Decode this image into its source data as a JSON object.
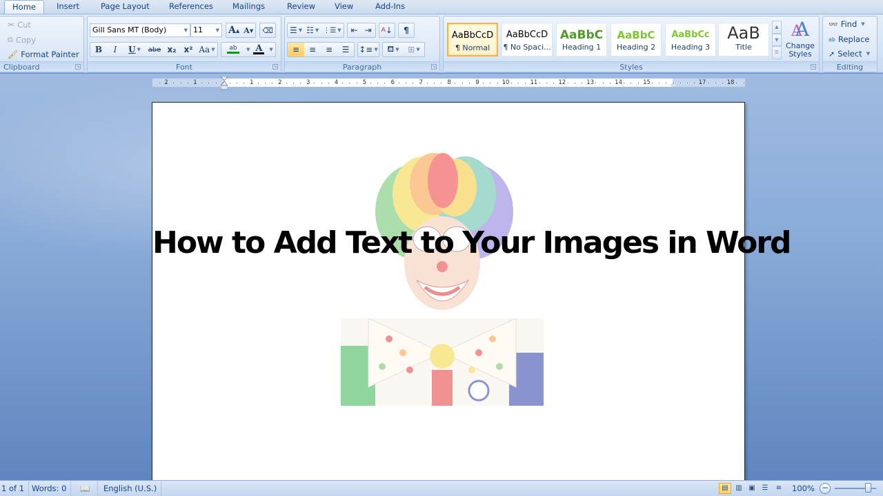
{
  "tabs": [
    {
      "label": "Home",
      "active": true
    },
    {
      "label": "Insert"
    },
    {
      "label": "Page Layout"
    },
    {
      "label": "References"
    },
    {
      "label": "Mailings"
    },
    {
      "label": "Review"
    },
    {
      "label": "View"
    },
    {
      "label": "Add-Ins"
    }
  ],
  "clipboard": {
    "label": "Clipboard",
    "cut": "Cut",
    "copy": "Copy",
    "format_painter": "Format Painter"
  },
  "font": {
    "label": "Font",
    "font_name": "Gill Sans MT (Body)",
    "font_size": "11",
    "grow": "A",
    "shrink": "A",
    "bold": "B",
    "italic": "I",
    "underline": "U",
    "strikethrough": "abe",
    "subscript": "x₂",
    "superscript": "x²",
    "change_case": "Aa",
    "highlight": "ab",
    "font_color_glyph": "A",
    "highlight_color": "#00a000",
    "font_color": "#000000"
  },
  "paragraph": {
    "label": "Paragraph",
    "pilcrow": "¶"
  },
  "styles": {
    "label": "Styles",
    "items": [
      {
        "sample": "AaBbCcD",
        "name": "¶ Normal",
        "selected": true
      },
      {
        "sample": "AaBbCcD",
        "name": "¶ No Spaci..."
      },
      {
        "sample": "AaBbC",
        "name": "Heading 1"
      },
      {
        "sample": "AaBbC",
        "name": "Heading 2"
      },
      {
        "sample": "AaBbCc",
        "name": "Heading 3"
      },
      {
        "sample": "AaB",
        "name": "Title"
      }
    ],
    "change_styles": "Change Styles"
  },
  "editing": {
    "label": "Editing",
    "find": "Find",
    "replace": "Replace",
    "select": "Select"
  },
  "ruler": {
    "left_numbers": [
      "2",
      "1"
    ],
    "numbers": [
      "1",
      "2",
      "3",
      "4",
      "5",
      "6",
      "7",
      "8",
      "9",
      "10",
      "11",
      "12",
      "13",
      "14",
      "15"
    ],
    "right_numbers": [
      "17",
      "18"
    ]
  },
  "document": {
    "title_text": "How to Add Text to Your Images in Word",
    "image_alt": "clown image"
  },
  "status": {
    "page": "1 of 1",
    "words": "Words: 0",
    "language": "English (U.S.)",
    "zoom": "100%"
  }
}
